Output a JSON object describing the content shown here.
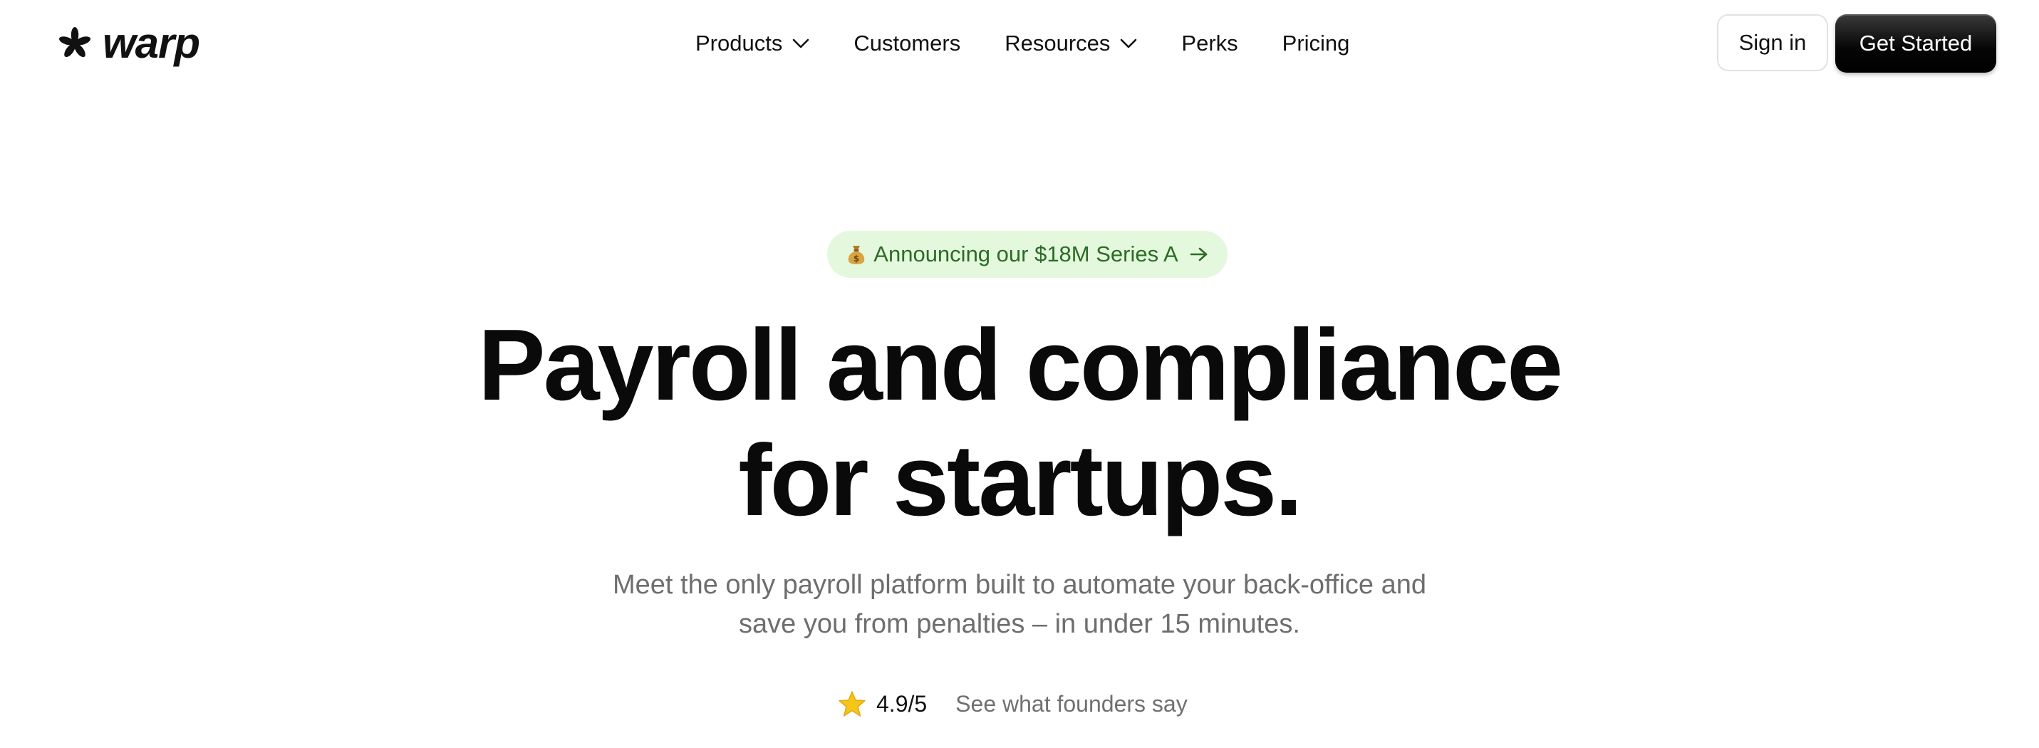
{
  "header": {
    "logo_text": "warp",
    "nav": {
      "products": "Products",
      "customers": "Customers",
      "resources": "Resources",
      "perks": "Perks",
      "pricing": "Pricing"
    },
    "sign_in": "Sign in",
    "get_started": "Get Started"
  },
  "hero": {
    "announcement": "Announcing our $18M Series A",
    "headline_line1": "Payroll and compliance",
    "headline_line2": "for startups.",
    "subtitle_line1": "Meet the only payroll platform built to automate your back-office and",
    "subtitle_line2": "save you from penalties – in under 15 minutes.",
    "rating_value": "4.9/5",
    "rating_link": "See what founders say"
  },
  "colors": {
    "announcement_bg": "#e3f8dc",
    "announcement_text": "#2c6b25",
    "primary_button_bg": "#000000",
    "star": "#f5c518"
  },
  "icons": {
    "logo": "asterisk-logo-icon",
    "nav_dropdown": "chevron-down-icon",
    "announcement_emoji": "money-bag-icon",
    "announcement_arrow": "arrow-right-icon",
    "rating": "star-icon"
  }
}
